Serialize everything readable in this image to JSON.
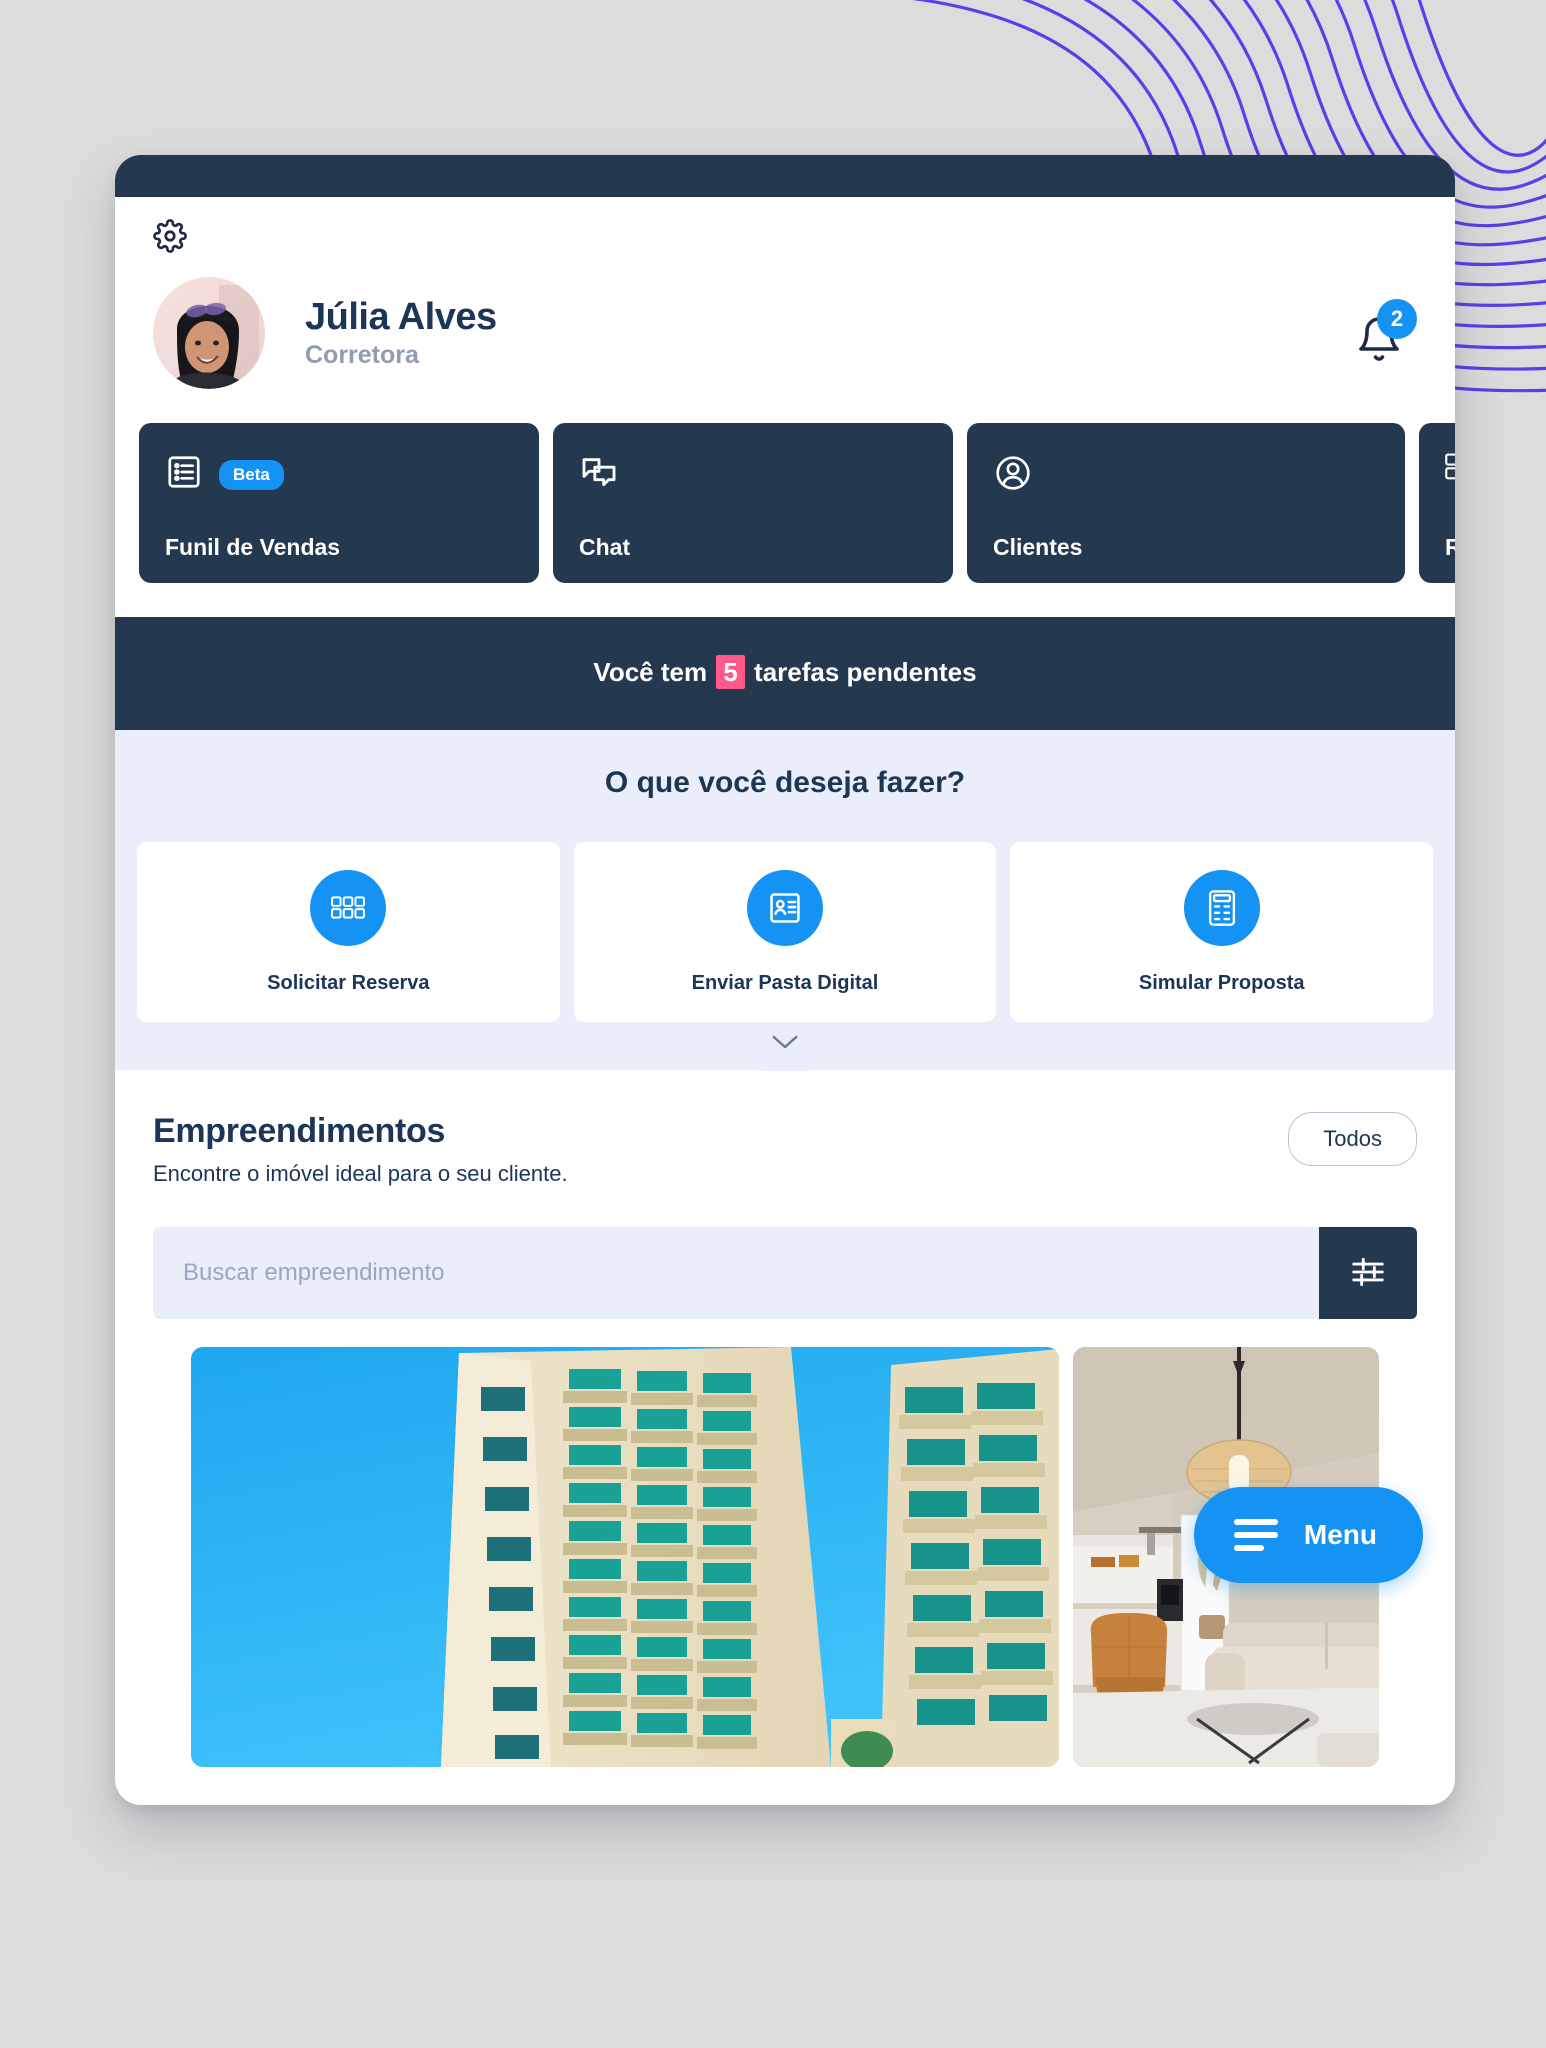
{
  "window": {
    "settings_icon": "gear-icon"
  },
  "profile": {
    "name": "Júlia Alves",
    "role": "Corretora",
    "avatar_alt": "avatar",
    "notifications": {
      "icon": "bell-icon",
      "count": "2"
    }
  },
  "quick_nav": [
    {
      "label": "Funil de Vendas",
      "icon": "list-icon",
      "badge": "Beta"
    },
    {
      "label": "Chat",
      "icon": "chat-bubbles-icon",
      "badge": ""
    },
    {
      "label": "Clientes",
      "icon": "user-circle-icon",
      "badge": ""
    },
    {
      "label": "Reserv",
      "icon": "grid-icon",
      "badge": ""
    }
  ],
  "tasks_banner": {
    "prefix": "Você  tem",
    "count": "5",
    "suffix": "tarefas pendentes"
  },
  "actions_panel": {
    "heading": "O que você deseja fazer?",
    "expand_icon": "chevron-down-icon",
    "items": [
      {
        "label": "Solicitar Reserva",
        "icon": "grid-icon"
      },
      {
        "label": "Enviar Pasta Digital",
        "icon": "id-card-icon"
      },
      {
        "label": "Simular Proposta",
        "icon": "calculator-icon"
      }
    ]
  },
  "listing": {
    "title": "Empreendimentos",
    "subtitle": "Encontre o imóvel ideal para o seu cliente.",
    "filter_all_label": "Todos",
    "search_placeholder": "Buscar empreendimento",
    "search_value": "",
    "filter_icon": "sliders-icon",
    "cards": [
      {
        "alt": "apartment-tower-photo"
      },
      {
        "alt": "living-room-interior-photo"
      }
    ]
  },
  "menu_fab": {
    "label": "Menu",
    "icon": "hamburger-icon"
  },
  "colors": {
    "navy": "#24394f",
    "blue": "#1493f5",
    "pink": "#ff5a8a",
    "lavender": "#eaeefb",
    "purple_waves": "#5b3ee8",
    "page_bg": "#dcdcdc"
  }
}
